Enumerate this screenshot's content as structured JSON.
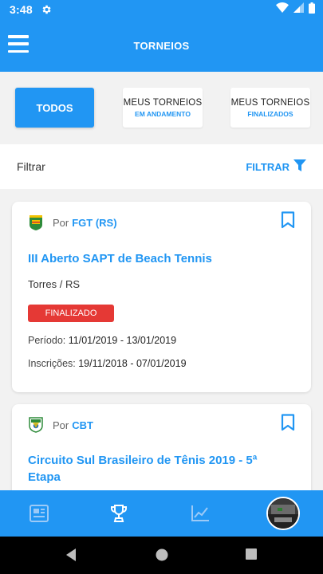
{
  "status_bar": {
    "time": "3:48"
  },
  "app_bar": {
    "title": "TORNEIOS"
  },
  "tabs": [
    {
      "label": "TODOS",
      "sub": ""
    },
    {
      "label": "MEUS TORNEIOS",
      "sub": "EM ANDAMENTO"
    },
    {
      "label": "MEUS TORNEIOS",
      "sub": "FINALIZADOS"
    }
  ],
  "filter": {
    "label": "Filtrar",
    "button": "FILTRAR"
  },
  "tournaments": [
    {
      "by": "Por",
      "organizer": "FGT (RS)",
      "title": "III Aberto SAPT de Beach Tennis",
      "location": "Torres / RS",
      "status": "FINALIZADO",
      "period_label": "Período:",
      "period": "11/01/2019 - 13/01/2019",
      "registration_label": "Inscrições:",
      "registration": "19/11/2018 - 07/01/2019"
    },
    {
      "by": "Por",
      "organizer": "CBT",
      "title": "Circuito Sul Brasileiro de Tênis 2019 - 5ª Etapa"
    }
  ],
  "colors": {
    "primary": "#2196f3",
    "status_finalizado": "#e53935"
  },
  "bottom_nav": [
    "news-icon",
    "trophy-icon",
    "chart-icon",
    "profile-avatar"
  ]
}
